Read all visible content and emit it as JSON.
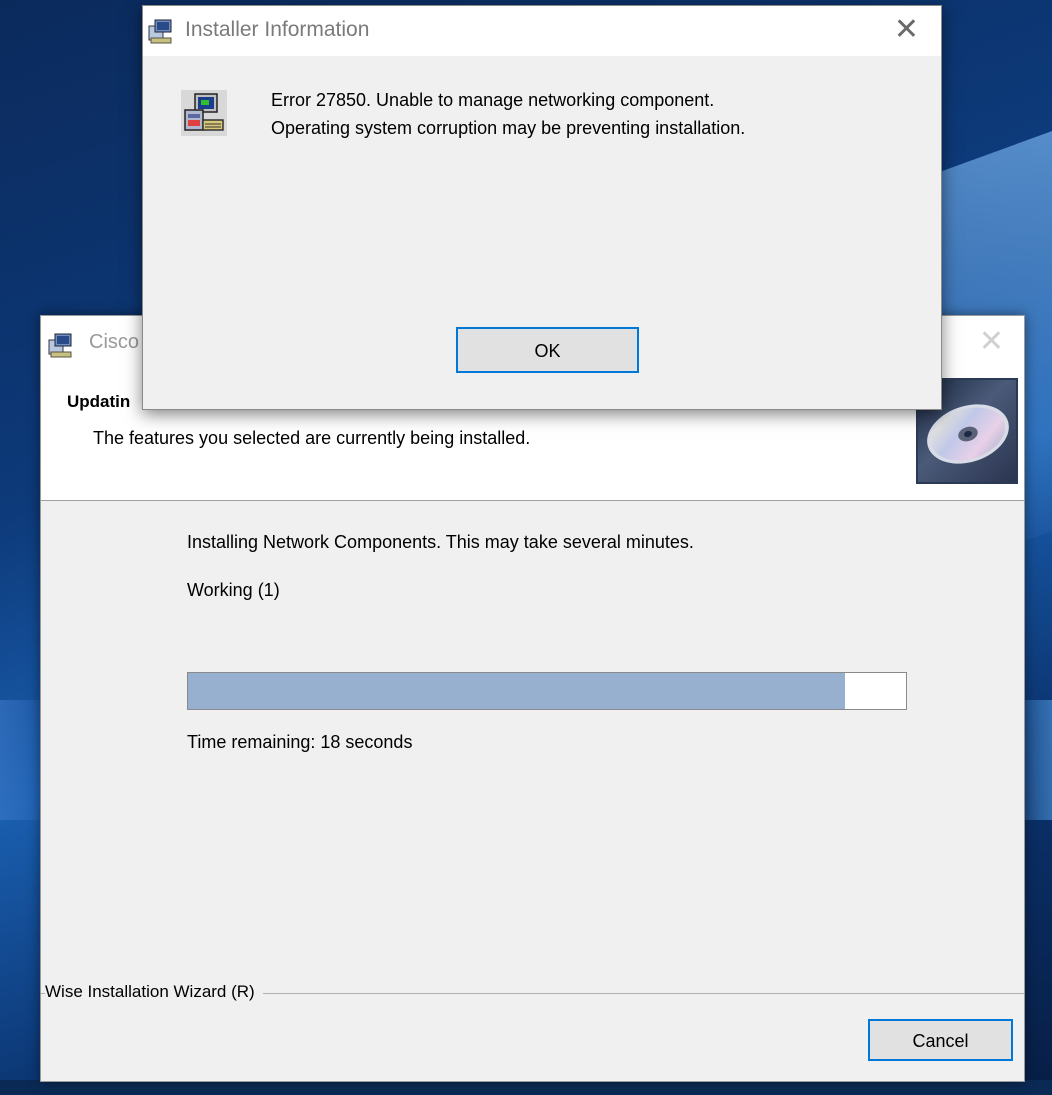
{
  "wizard": {
    "title": "Cisco",
    "header_title": "Updatin",
    "header_subtitle": "The features you selected are currently being installed.",
    "status_line": "Installing Network Components. This may take several minutes.",
    "working_line": "Working  (1)",
    "progress_fraction": 0.915,
    "time_remaining": "Time remaining: 18 seconds",
    "brand": "Wise Installation Wizard (R)",
    "cancel_label": "Cancel",
    "close_label": "✕"
  },
  "dialog": {
    "title": "Installer Information",
    "message_line1": "Error 27850. Unable to manage networking component.",
    "message_line2": "Operating system corruption may be preventing installation.",
    "ok_label": "OK",
    "close_label": "✕"
  },
  "icons": {
    "installer_icon": "installer-icon",
    "computer_setup_icon": "computer-setup-icon",
    "cd_icon": "cd-icon"
  }
}
